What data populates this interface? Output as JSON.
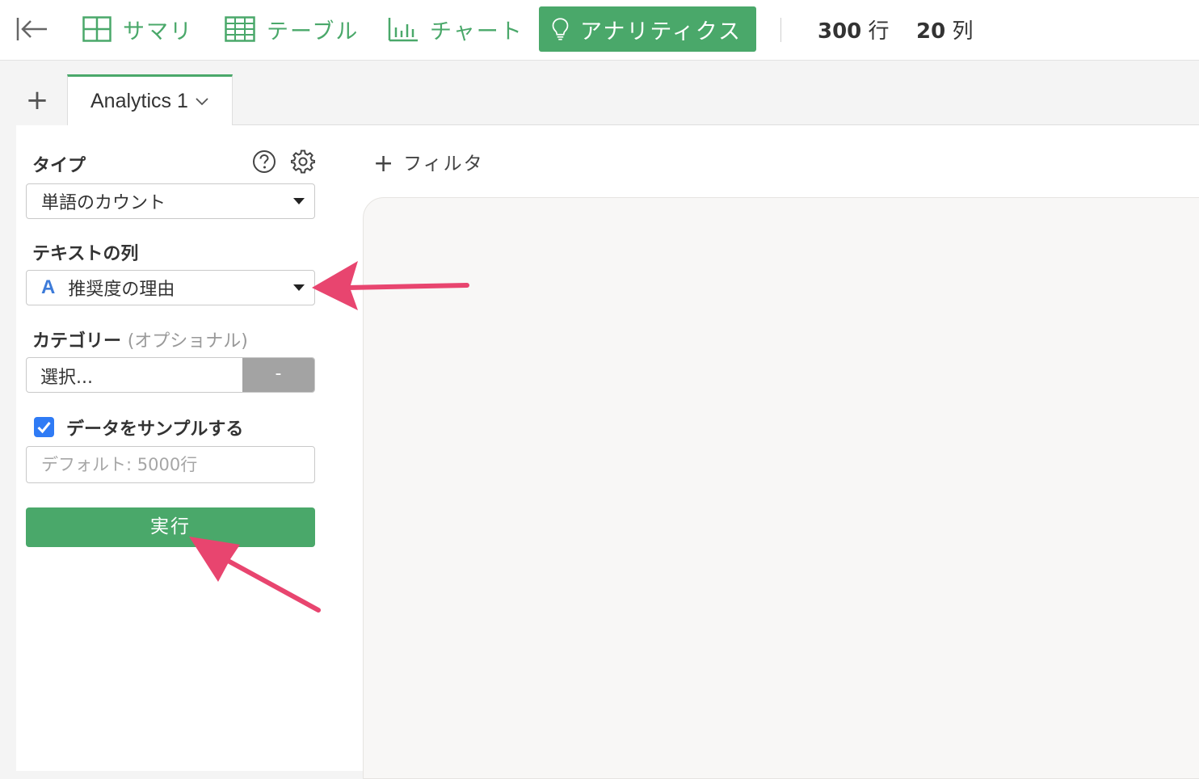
{
  "toolbar": {
    "summary_label": "サマリ",
    "table_label": "テーブル",
    "chart_label": "チャート",
    "analytics_label": "アナリティクス",
    "rows_number": "300",
    "rows_unit": "行",
    "cols_number": "20",
    "cols_unit": "列"
  },
  "tabs": {
    "add_label": "+",
    "active_label": "Analytics 1"
  },
  "panel": {
    "type_label": "タイプ",
    "type_value": "単語のカウント",
    "text_column_label": "テキストの列",
    "text_column_type_icon": "A",
    "text_column_value": "推奨度の理由",
    "category_label": "カテゴリー",
    "category_optional": "(オプショナル)",
    "category_placeholder": "選択...",
    "category_clear_label": "-",
    "sample_label": "データをサンプルする",
    "sample_checked": true,
    "sample_placeholder": "デフォルト: 5000行",
    "run_label": "実行"
  },
  "filter": {
    "add_label": "フィルタ"
  },
  "colors": {
    "accent": "#4aa86a",
    "checkbox": "#2f7bf5",
    "arrow": "#e8456f",
    "column_type_icon": "#3d7bd9"
  },
  "icons": [
    "back-to-start-icon",
    "summary-grid-icon",
    "table-grid-icon",
    "bar-chart-icon",
    "lightbulb-icon",
    "help-icon",
    "gear-icon",
    "chevron-down-icon",
    "plus-icon"
  ]
}
